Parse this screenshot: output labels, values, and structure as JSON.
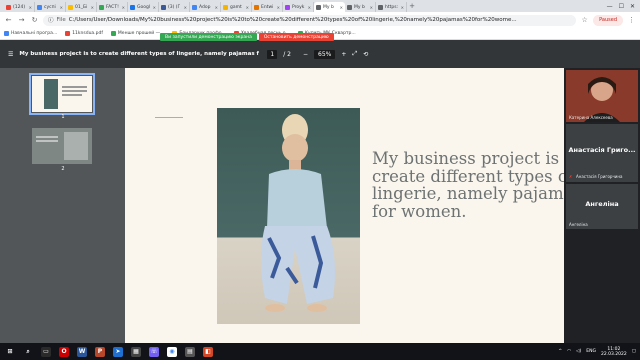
{
  "tabs": [
    {
      "label": "(124)",
      "color": "#ea4335"
    },
    {
      "label": "суспі",
      "color": "#4285f4"
    },
    {
      "label": "01_Бі",
      "color": "#fbbc04"
    },
    {
      "label": "FACT!",
      "color": "#34a853"
    },
    {
      "label": "Googl",
      "color": "#1a73e8"
    },
    {
      "label": "(3) (Г",
      "color": "#3b5998"
    },
    {
      "label": "Adop",
      "color": "#4285f4"
    },
    {
      "label": "gamt",
      "color": "#f4b400"
    },
    {
      "label": "Entwi",
      "color": "#e37400"
    },
    {
      "label": "Proyk",
      "color": "#a142f4"
    },
    {
      "label": "My b",
      "color": "#5f6368",
      "active": true
    },
    {
      "label": "My b",
      "color": "#5f6368"
    },
    {
      "label": "https:",
      "color": "#5f6368"
    }
  ],
  "window": {
    "minimize": "—",
    "maximize": "☐",
    "close": "✕"
  },
  "address": {
    "info": "File",
    "url": "C:/Users/User/Downloads/My%20business%20project%20is%20to%20create%20different%20types%20of%20lingerie,%20namely%20pajamas%20for%20wome...",
    "pause": "Paused"
  },
  "bookmarks": [
    {
      "label": "Навчальні програ...",
      "color": "#4285f4"
    },
    {
      "label": "11knsdua.pdf",
      "color": "#ea4335"
    },
    {
      "label": "Менше прошей —...",
      "color": "#34a853"
    },
    {
      "label": "Бондарчук профо...",
      "color": "#fbbc04"
    },
    {
      "label": "Хвалебная песнь о...",
      "color": "#ea4335"
    },
    {
      "label": "Купить МК Сквартр...",
      "color": "#34a853"
    }
  ],
  "share": {
    "active": "Ви запустили демонстрацию экрана",
    "stop": "Остановить демонстрацию"
  },
  "pdf": {
    "title": "My business project is to create different types of lingerie, namely pajamas for wom...",
    "page": "1",
    "total": "/ 2",
    "zoom": "65%"
  },
  "thumbs": [
    {
      "num": "1"
    },
    {
      "num": "2"
    }
  ],
  "slide": {
    "text": [
      "My business project is to",
      "create different types of",
      "lingerie, namely pajamas",
      "for women."
    ]
  },
  "meet": {
    "self_name": "Катерина Алексеева",
    "p1": "Анастасія Григо...",
    "p1_sub": "Анастасія Григорчина",
    "p2": "Ангеліна",
    "p2_sub": "Ангеліна"
  },
  "taskbar": {
    "lang": "ENG",
    "time": "11:02",
    "date": "22.03.2022"
  }
}
